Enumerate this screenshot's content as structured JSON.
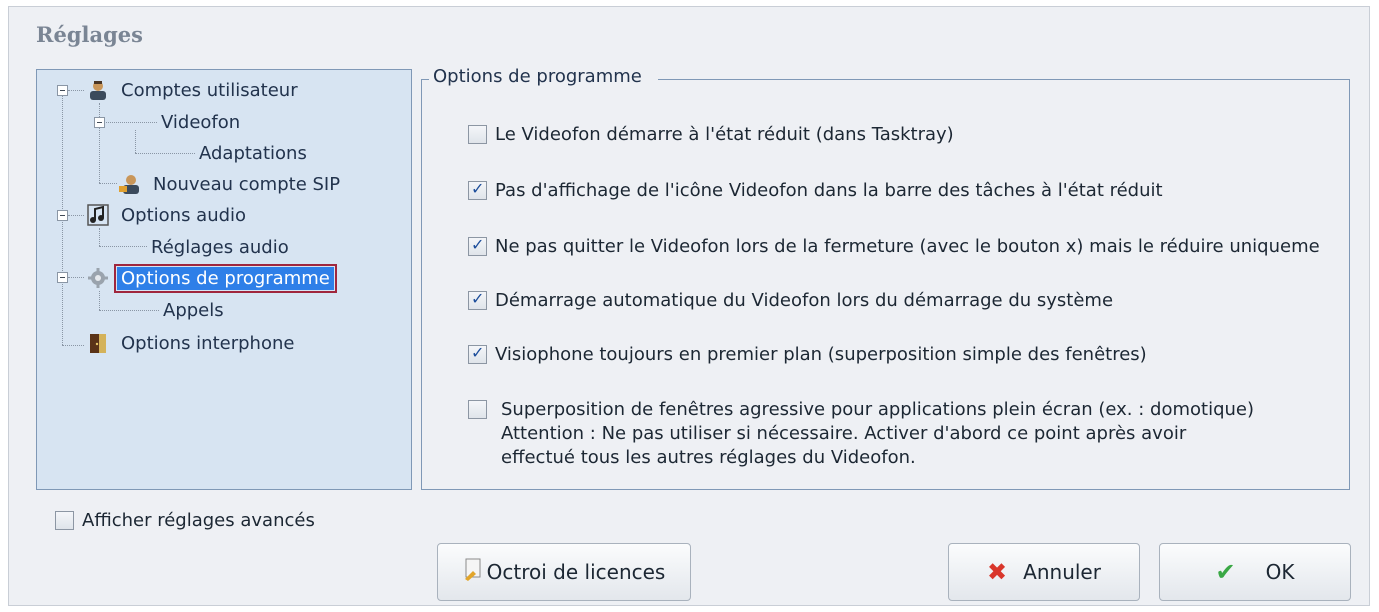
{
  "dialog": {
    "title": "Réglages"
  },
  "tree": {
    "items": [
      {
        "label": "Comptes utilisateur",
        "icon": "user-icon"
      },
      {
        "label": "Videofon"
      },
      {
        "label": "Adaptations"
      },
      {
        "label": "Nouveau compte SIP",
        "icon": "user-add-icon"
      },
      {
        "label": "Options audio",
        "icon": "music-note-icon"
      },
      {
        "label": "Réglages audio"
      },
      {
        "label": "Options de programme",
        "icon": "gear-icon",
        "selected": true
      },
      {
        "label": "Appels"
      },
      {
        "label": "Options interphone",
        "icon": "door-icon"
      }
    ]
  },
  "options": {
    "group_title": "Options de programme",
    "items": [
      {
        "label": "Le Videofon démarre à l'état réduit (dans Tasktray)",
        "checked": false
      },
      {
        "label": "Pas d'affichage de l'icône Videofon dans la barre des tâches à l'état réduit",
        "checked": true
      },
      {
        "label": "Ne pas quitter le Videofon lors de la fermeture (avec le bouton x) mais le réduire uniqueme",
        "checked": true
      },
      {
        "label": "Démarrage automatique du Videofon lors du démarrage du système",
        "checked": true
      },
      {
        "label": "Visiophone toujours en premier plan (superposition simple des fenêtres)",
        "checked": true
      },
      {
        "lines": [
          "Superposition de fenêtres agressive pour applications plein écran (ex. : domotique)",
          "Attention : Ne pas utiliser si nécessaire. Activer d'abord ce point après avoir",
          "effectué tous les autres réglages du Videofon."
        ],
        "checked": false
      }
    ]
  },
  "advanced": {
    "label": "Afficher réglages avancés",
    "checked": false
  },
  "buttons": {
    "license": "Octroi de licences",
    "cancel": "Annuler",
    "ok": "OK"
  },
  "colors": {
    "selection": "#2e7fe8",
    "selection_outline": "#a0263d",
    "check": "#1d4e9b",
    "cancel_x": "#d9362b",
    "ok_check": "#3aa845"
  }
}
